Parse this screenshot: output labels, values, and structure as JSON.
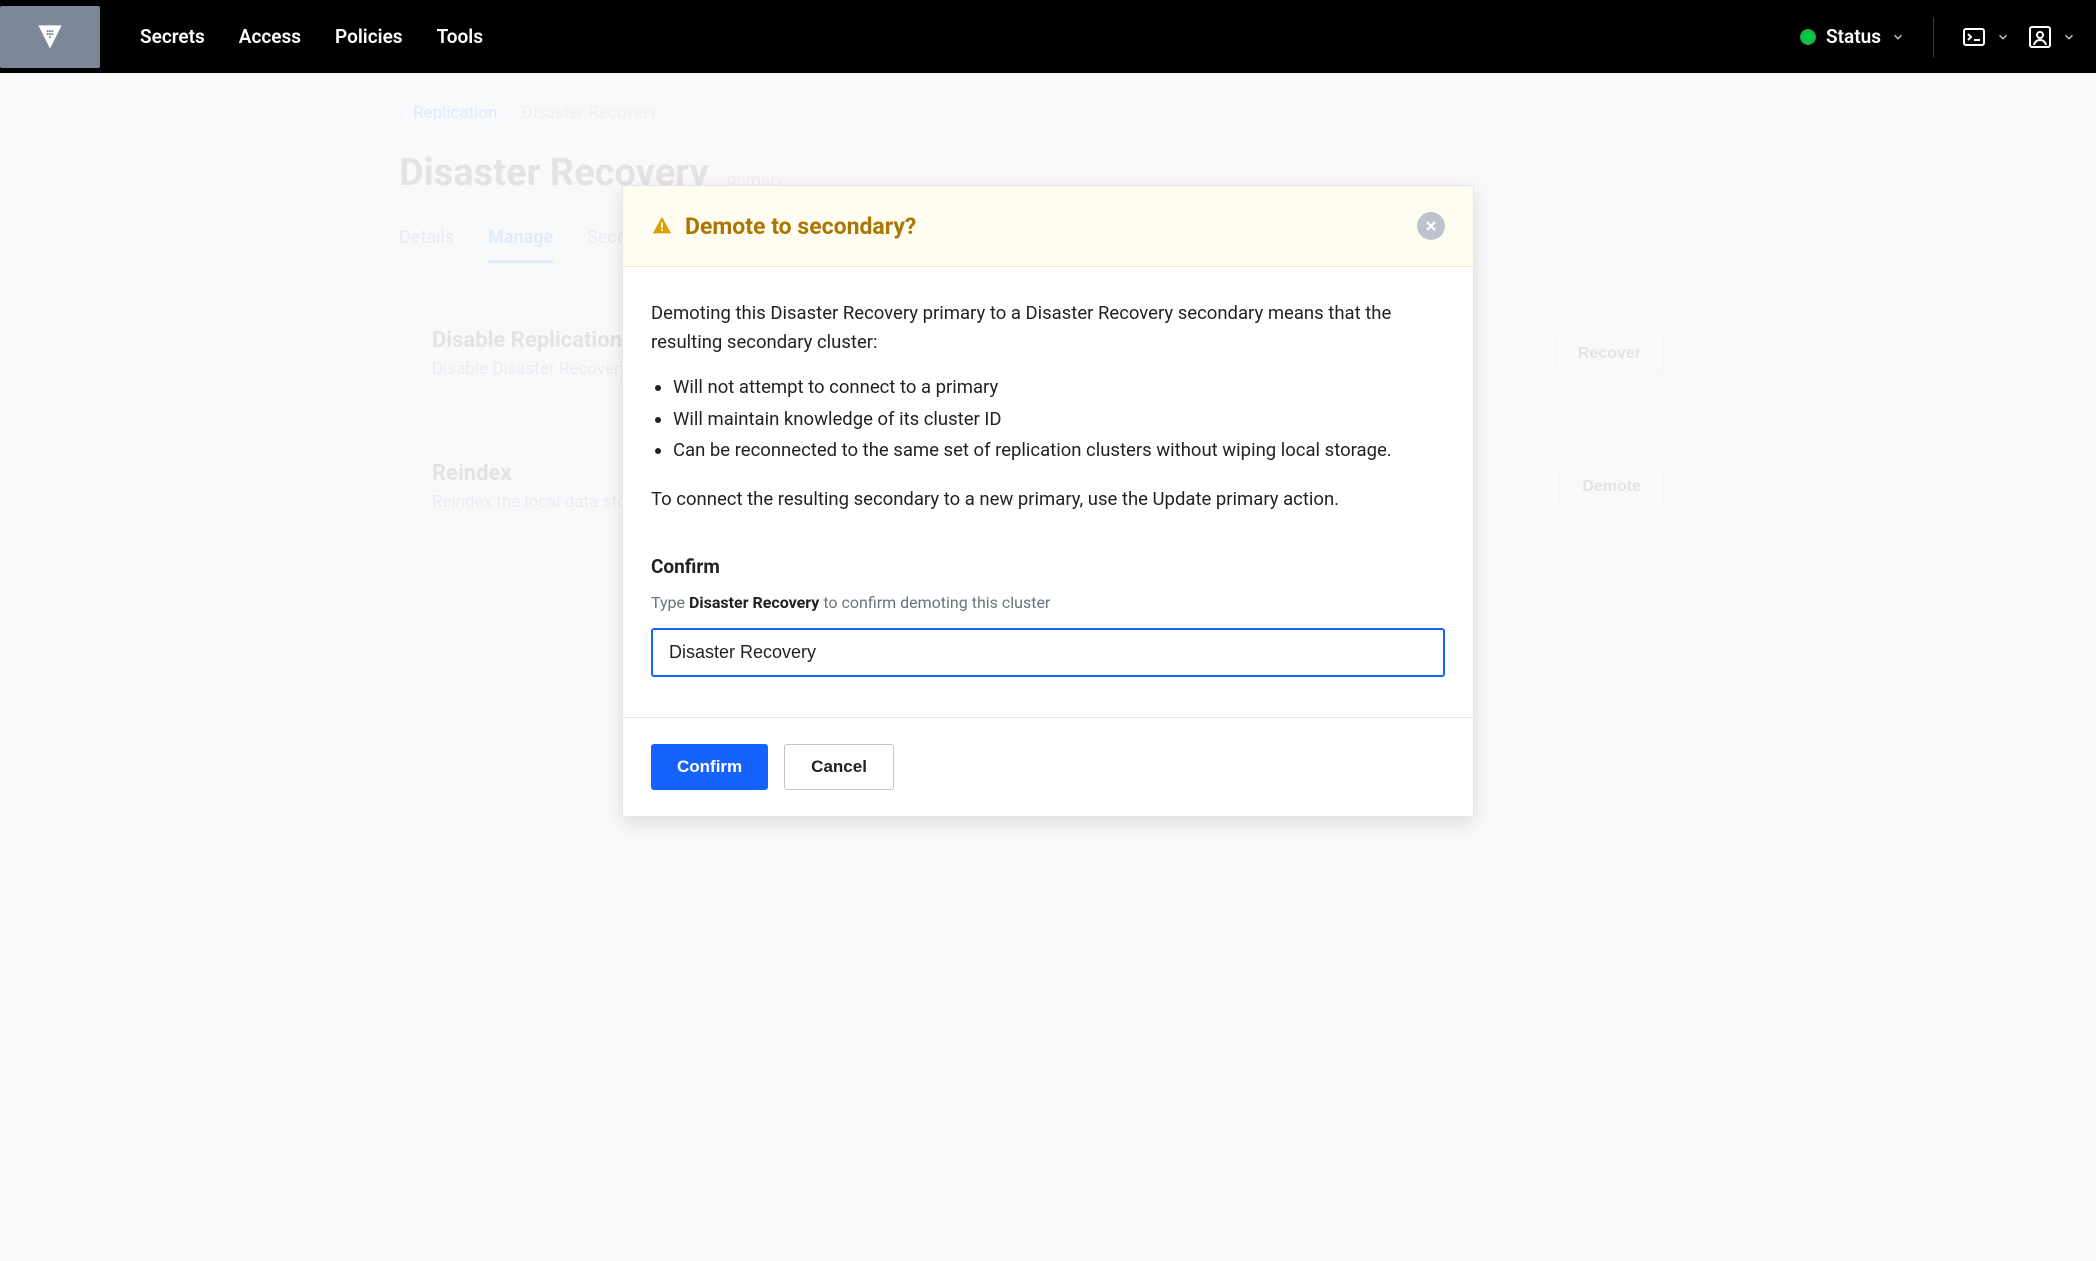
{
  "nav": {
    "items": [
      "Secrets",
      "Access",
      "Policies",
      "Tools"
    ],
    "status_label": "Status"
  },
  "breadcrumb": {
    "link": "Replication",
    "current": "Disaster Recovery"
  },
  "page": {
    "title": "Disaster Recovery",
    "badge": "primary"
  },
  "tabs": {
    "items": [
      "Details",
      "Manage",
      "Secondaries"
    ],
    "active_index": 1
  },
  "cards": [
    {
      "title": "Disable Replication",
      "desc": "Disable Disaster Recovery Replication entirely on the cluster.",
      "button": "Recover"
    },
    {
      "title": "Reindex",
      "desc": "Reindex the local data storage.",
      "button": "Demote"
    }
  ],
  "modal": {
    "title": "Demote to secondary?",
    "intro": "Demoting this Disaster Recovery primary to a Disaster Recovery secondary means that the resulting secondary cluster:",
    "bullets": [
      "Will not attempt to connect to a primary",
      "Will maintain knowledge of its cluster ID",
      "Can be reconnected to the same set of replication clusters without wiping local storage."
    ],
    "outro": "To connect the resulting secondary to a new primary, use the Update primary action.",
    "confirm_label": "Confirm",
    "confirm_hint_pre": "Type ",
    "confirm_hint_strong": "Disaster Recovery",
    "confirm_hint_post": " to confirm demoting this cluster",
    "input_value": "Disaster Recovery",
    "confirm_btn": "Confirm",
    "cancel_btn": "Cancel"
  }
}
